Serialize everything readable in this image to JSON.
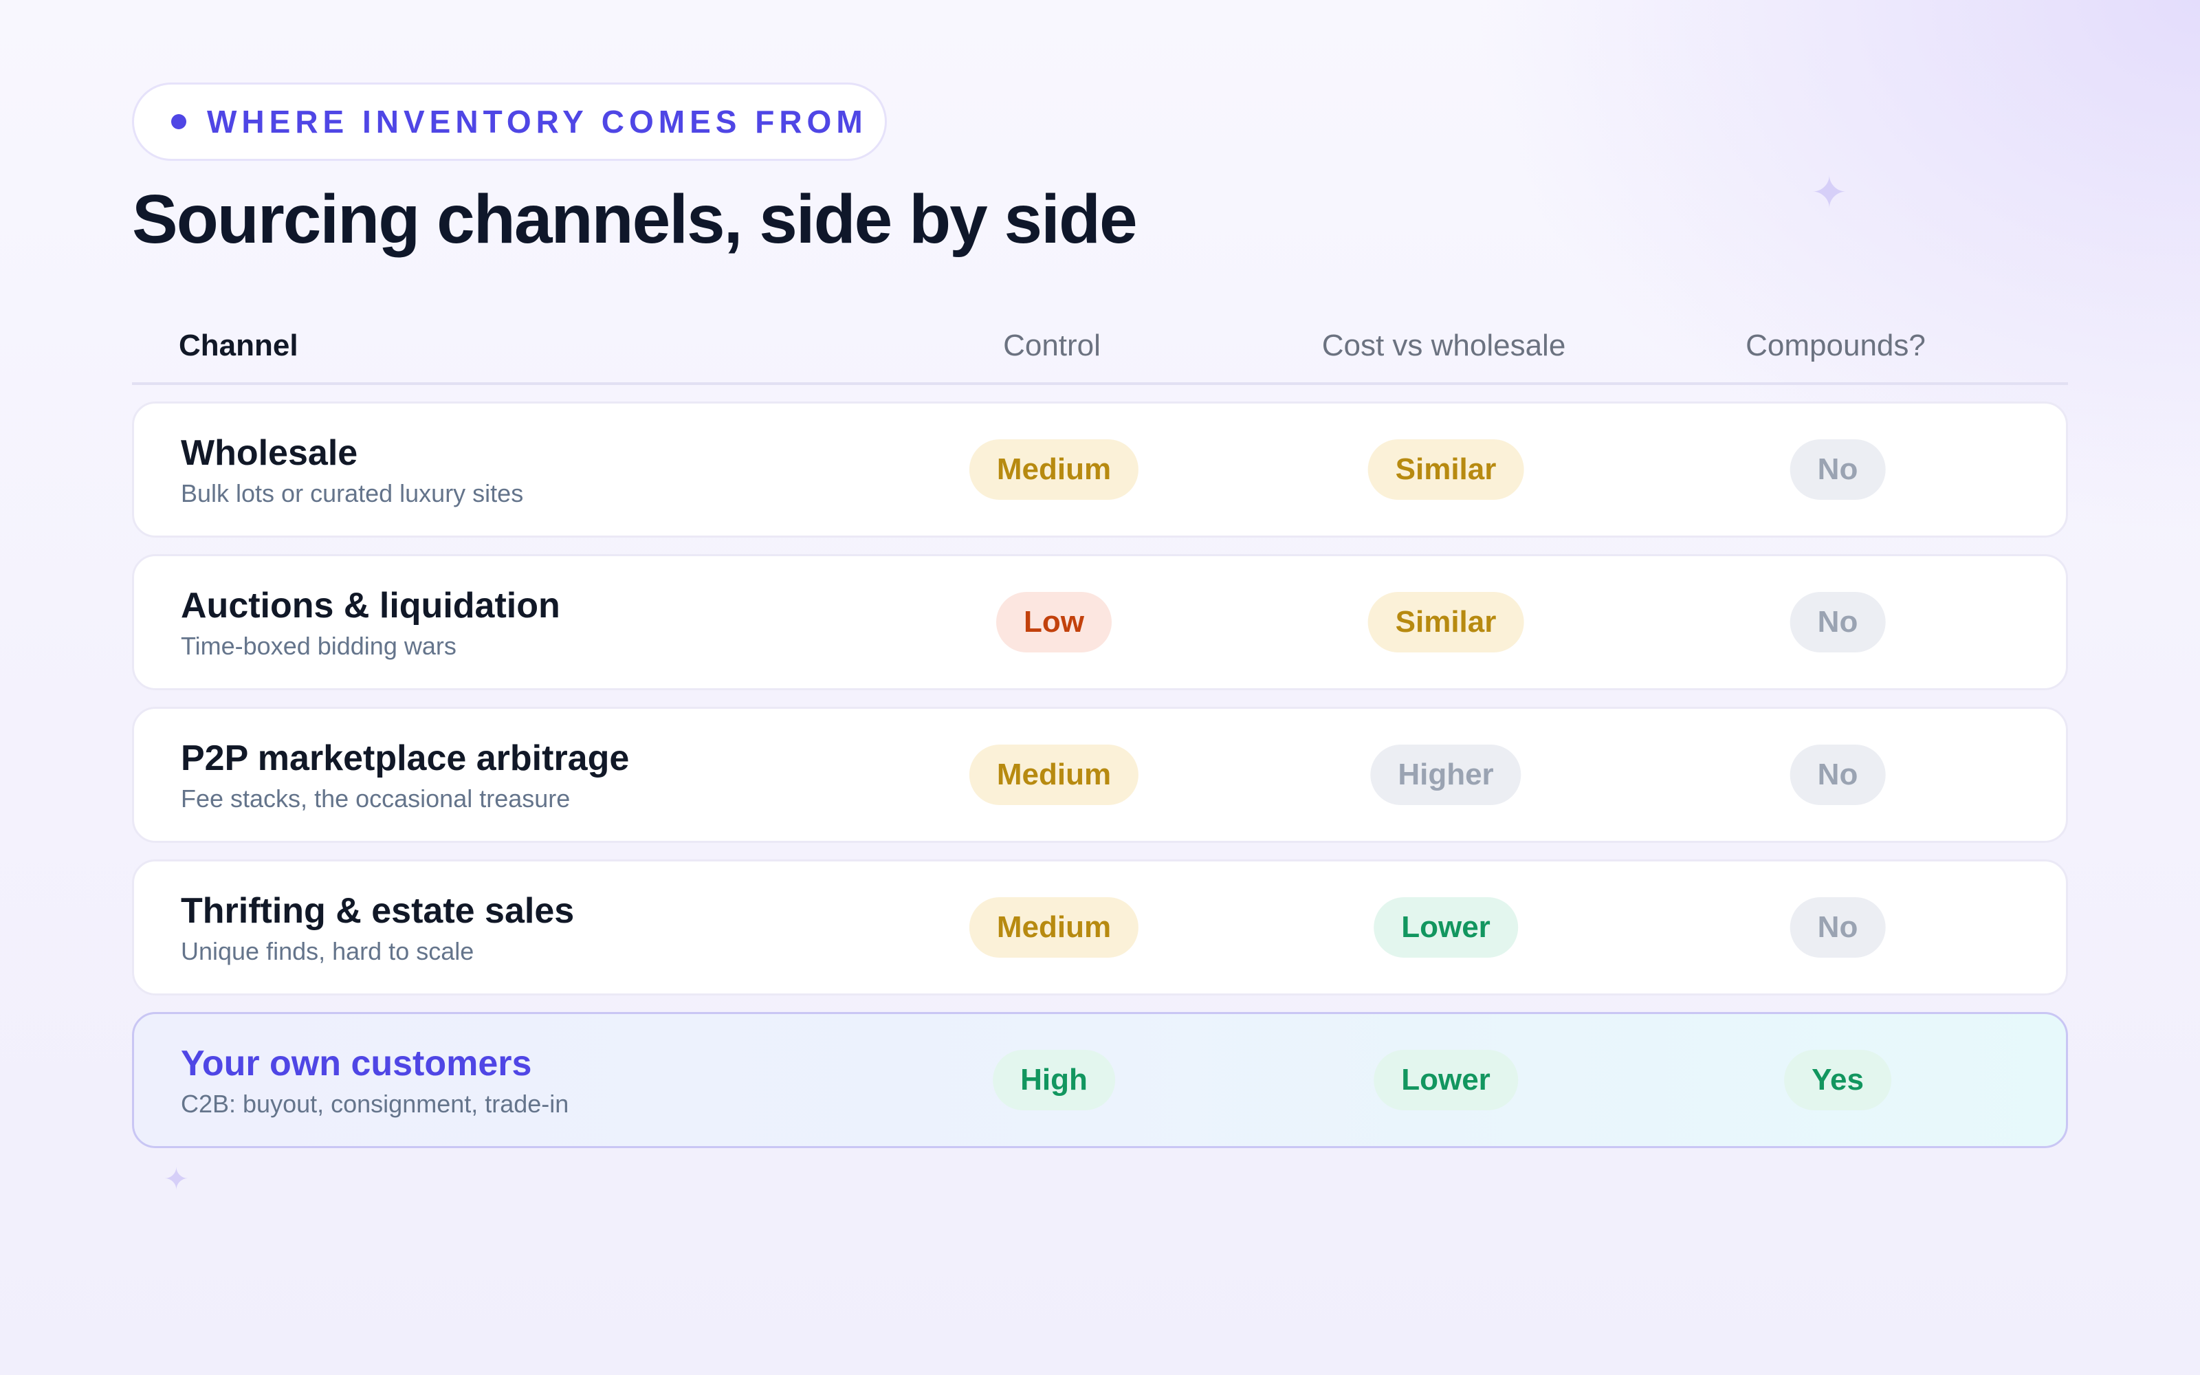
{
  "eyebrow": "WHERE INVENTORY COMES FROM",
  "title": "Sourcing channels, side by side",
  "table": {
    "headers": {
      "channel": "Channel",
      "control": "Control",
      "cost": "Cost vs wholesale",
      "compounds": "Compounds?"
    },
    "rows": [
      {
        "name": "Wholesale",
        "desc": "Bulk lots or curated luxury sites",
        "control": "Medium",
        "cost": "Similar",
        "compounds": "No"
      },
      {
        "name": "Auctions & liquidation",
        "desc": "Time-boxed bidding wars",
        "control": "Low",
        "cost": "Similar",
        "compounds": "No"
      },
      {
        "name": "P2P marketplace arbitrage",
        "desc": "Fee stacks, the occasional treasure",
        "control": "Medium",
        "cost": "Higher",
        "compounds": "No"
      },
      {
        "name": "Thrifting & estate sales",
        "desc": "Unique finds, hard to scale",
        "control": "Medium",
        "cost": "Lower",
        "compounds": "No"
      },
      {
        "name": "Your own customers",
        "desc": "C2B: buyout, consignment, trade-in",
        "control": "High",
        "cost": "Lower",
        "compounds": "Yes",
        "highlighted": true
      }
    ]
  },
  "colors": {
    "accent": "#4f46e5",
    "amber_text": "#b78a10",
    "red_text": "#c2410c",
    "green_text": "#12965f",
    "gray_text": "#9aa3b2"
  },
  "icons": {
    "eyebrow_dot": "dot-icon",
    "decoration": "sparkle-icon"
  }
}
